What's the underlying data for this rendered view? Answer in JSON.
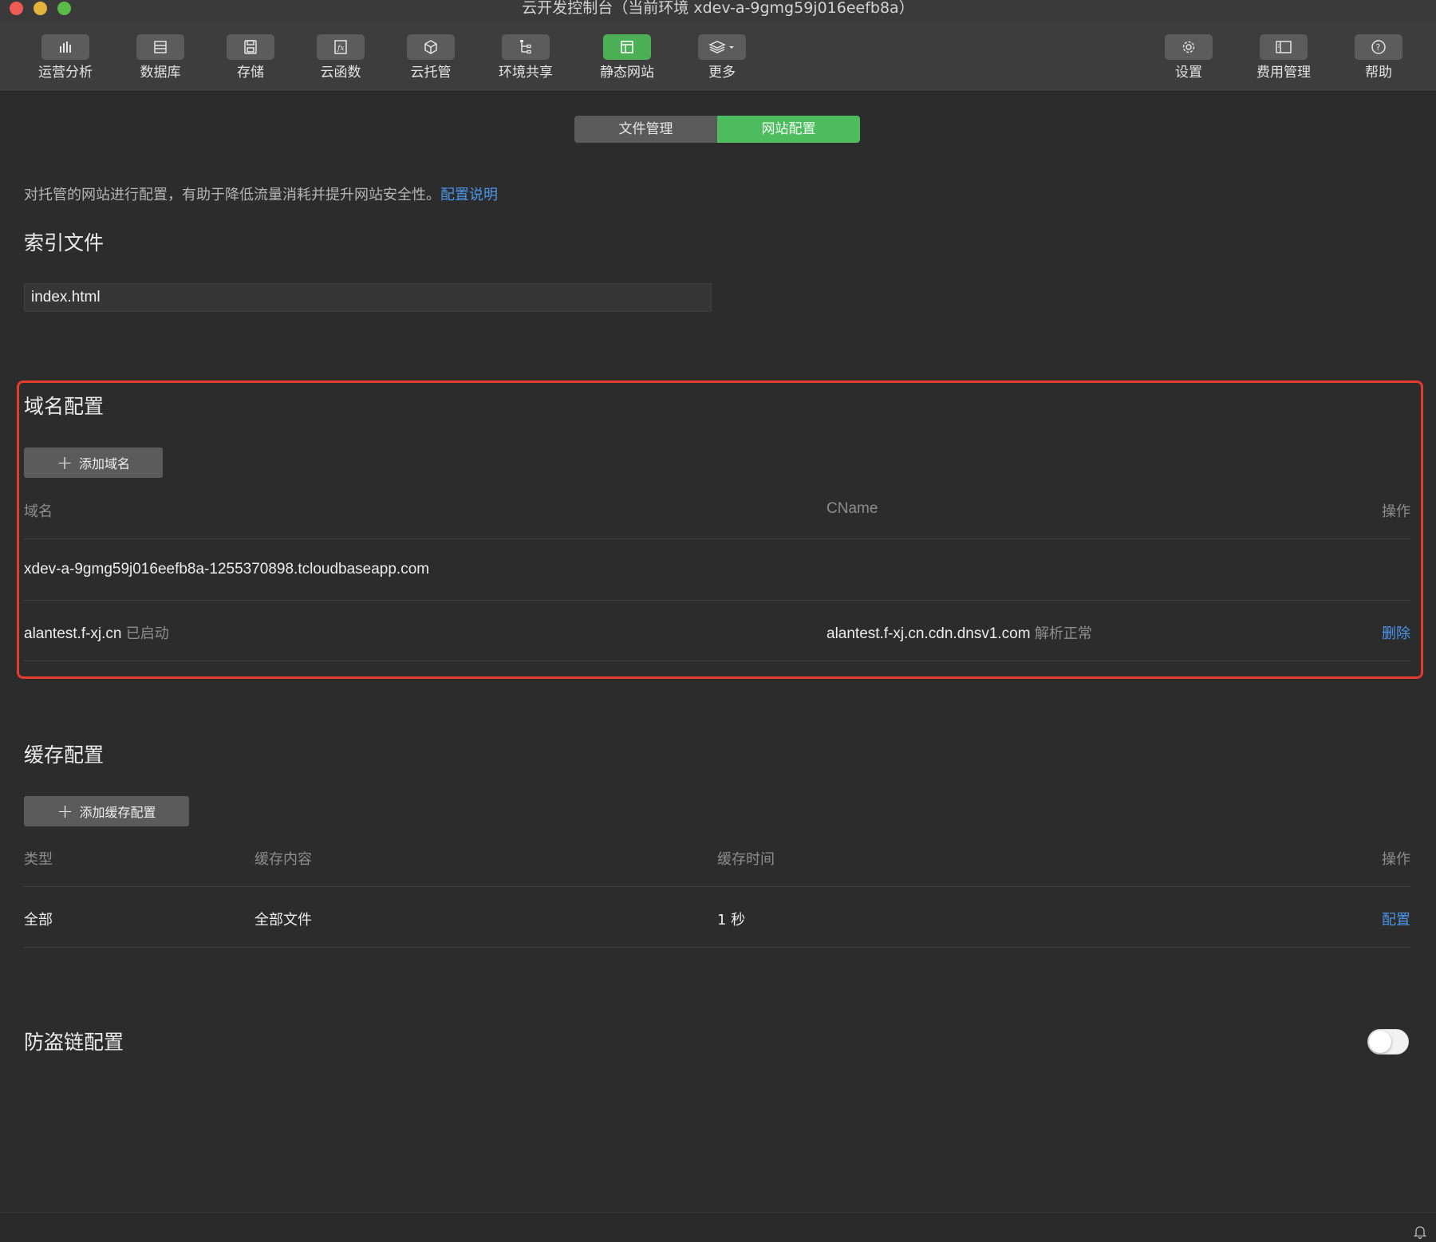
{
  "window": {
    "title": "云开发控制台（当前环境 xdev-a-9gmg59j016eefb8a）"
  },
  "toolbar": {
    "left": [
      {
        "label": "运营分析",
        "icon": "bar-chart-icon"
      },
      {
        "label": "数据库",
        "icon": "database-icon"
      },
      {
        "label": "存储",
        "icon": "floppy-disk-icon"
      },
      {
        "label": "云函数",
        "icon": "function-icon"
      },
      {
        "label": "云托管",
        "icon": "cube-icon"
      },
      {
        "label": "环境共享",
        "icon": "tree-share-icon"
      },
      {
        "label": "静态网站",
        "icon": "browser-window-icon",
        "active": true
      },
      {
        "label": "更多",
        "icon": "layers-dropdown-icon"
      }
    ],
    "right": [
      {
        "label": "设置",
        "icon": "gear-icon"
      },
      {
        "label": "费用管理",
        "icon": "billing-panel-icon"
      },
      {
        "label": "帮助",
        "icon": "help-circle-icon"
      }
    ]
  },
  "tabs": {
    "file_management": "文件管理",
    "site_config": "网站配置",
    "active": "site_config"
  },
  "intro": {
    "text": "对托管的网站进行配置，有助于降低流量消耗并提升网站安全性。",
    "link": "配置说明"
  },
  "index_file": {
    "title": "索引文件",
    "value": "index.html"
  },
  "domain_config": {
    "title": "域名配置",
    "add_button": "添加域名",
    "columns": {
      "domain": "域名",
      "cname": "CName",
      "action": "操作"
    },
    "rows": [
      {
        "domain": "xdev-a-9gmg59j016eefb8a-1255370898.tcloudbaseapp.com",
        "status": "",
        "cname": "",
        "cname_status": "",
        "action": ""
      },
      {
        "domain": "alantest.f-xj.cn",
        "status": "已启动",
        "cname": "alantest.f-xj.cn.cdn.dnsv1.com",
        "cname_status": "解析正常",
        "action": "删除"
      }
    ]
  },
  "cache_config": {
    "title": "缓存配置",
    "add_button": "添加缓存配置",
    "columns": {
      "type": "类型",
      "content": "缓存内容",
      "time": "缓存时间",
      "action": "操作"
    },
    "rows": [
      {
        "type": "全部",
        "content": "全部文件",
        "time": "1 秒",
        "action": "配置"
      }
    ]
  },
  "hotlink_config": {
    "title": "防盗链配置",
    "enabled": false
  },
  "colors": {
    "accent_green": "#4cbc5e",
    "link_blue": "#4a95e8",
    "highlight_red": "#e33b2c",
    "background": "#2c2c2c"
  }
}
